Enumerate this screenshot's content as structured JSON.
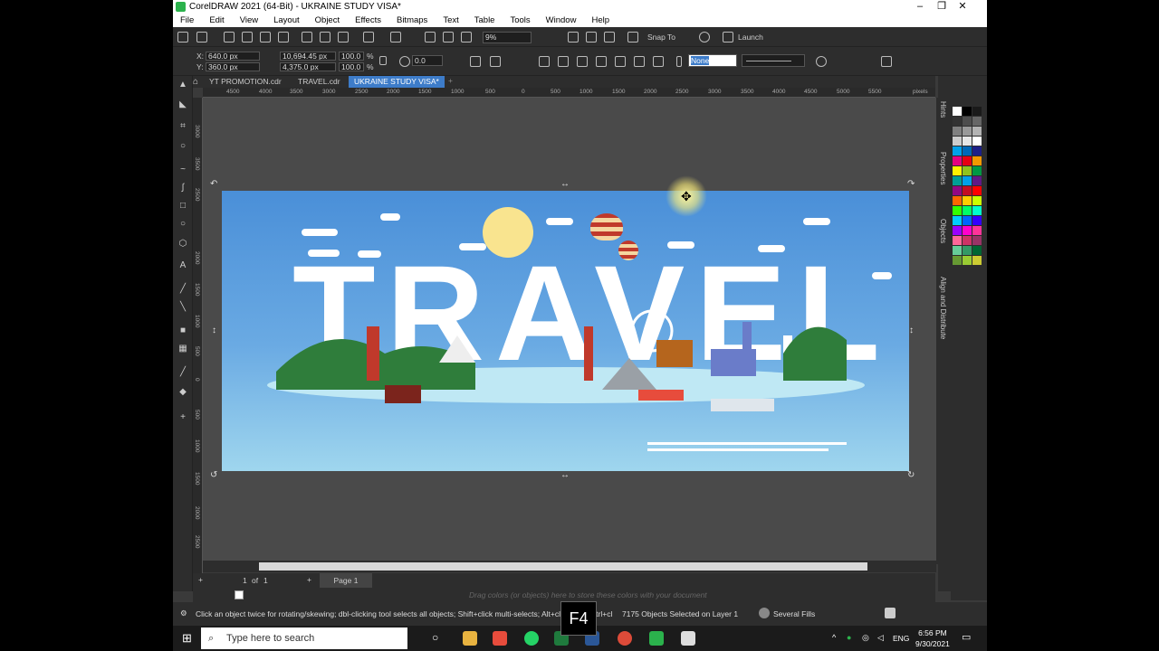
{
  "window": {
    "title": "CorelDRAW 2021 (64-Bit) - UKRAINE STUDY VISA*",
    "minimize": "–",
    "maximize": "❐",
    "close": "✕"
  },
  "menu": [
    "File",
    "Edit",
    "View",
    "Layout",
    "Object",
    "Effects",
    "Bitmaps",
    "Text",
    "Table",
    "Tools",
    "Window",
    "Help"
  ],
  "toolbar": {
    "zoom_value": "9%",
    "snap_to": "Snap To",
    "launch": "Launch"
  },
  "property_bar": {
    "x_label": "X:",
    "x_value": "640.0 px",
    "y_label": "Y:",
    "y_value": "360.0 px",
    "width_value": "10,694.45 px",
    "height_value": "4,375.0 px",
    "scale_x": "100.0",
    "scale_y": "100.0",
    "percent": "%",
    "rotation": "0.0",
    "outline_value": "None"
  },
  "doc_tabs": [
    "YT PROMOTION.cdr",
    "TRAVEL.cdr",
    "UKRAINE STUDY VISA*"
  ],
  "ruler": {
    "h_ticks": [
      "4500",
      "4000",
      "3500",
      "3000",
      "2500",
      "2000",
      "1500",
      "1000",
      "500",
      "0",
      "500",
      "1000",
      "1500",
      "2000",
      "2500",
      "3000",
      "3500",
      "4000",
      "4500",
      "5000",
      "5500"
    ],
    "units": "pixels",
    "v_ticks": [
      "3000",
      "3500",
      "2500",
      "2000",
      "1500",
      "1000",
      "500",
      "0",
      "500",
      "1000",
      "1500",
      "2000",
      "2500"
    ]
  },
  "artwork": {
    "headline": "TRAVEL"
  },
  "page_nav": {
    "current": "1",
    "of": "of",
    "total": "1",
    "page_tab": "Page 1"
  },
  "color_bar_hint": "Drag colors (or objects) here to store these colors with your document",
  "dockers": [
    "Hints",
    "Properties",
    "Objects",
    "Align and Distribute"
  ],
  "status": {
    "hint": "Click an object twice for rotating/skewing; dbl-clicking tool selects all objects; Shift+click multi-selects; Alt+click digs; Ctrl+cl",
    "selection": "7175 Objects Selected on Layer 1",
    "fill": "Several Fills"
  },
  "key_overlay": "F4",
  "taskbar": {
    "search_placeholder": "Type here to search",
    "language": "ENG",
    "time": "6:56 PM",
    "date": "9/30/2021"
  },
  "palette_colors": [
    "#ffffff",
    "#000000",
    "#1a1a1a",
    "#333333",
    "#4d4d4d",
    "#666666",
    "#808080",
    "#999999",
    "#b3b3b3",
    "#cccccc",
    "#e6e6e6",
    "#ffffff",
    "#00a0e9",
    "#0068b7",
    "#1d2088",
    "#e4007f",
    "#e60012",
    "#f39800",
    "#fff100",
    "#8fc31f",
    "#009944",
    "#009e96",
    "#00a0e9",
    "#601986",
    "#920783",
    "#c30d23",
    "#ff0000",
    "#ff6600",
    "#ffcc00",
    "#ccff00",
    "#33ff00",
    "#00ff66",
    "#00ffcc",
    "#00ccff",
    "#0066ff",
    "#3300ff",
    "#9900ff",
    "#ff00cc",
    "#ff3399",
    "#ff6699",
    "#cc3366",
    "#993366",
    "#66cc99",
    "#339966",
    "#006633",
    "#669933",
    "#99cc33",
    "#cccc33"
  ],
  "accent": "#3d7cc9"
}
